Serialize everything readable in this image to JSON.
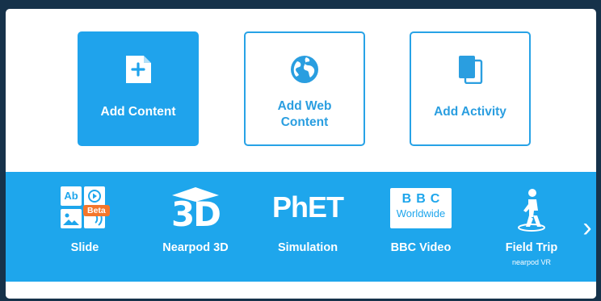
{
  "cards": {
    "add_content": "Add Content",
    "add_web_content_line1": "Add Web",
    "add_web_content_line2": "Content",
    "add_activity": "Add Activity"
  },
  "tools": {
    "slide": {
      "label": "Slide",
      "badge": "Beta",
      "ab": "Ab"
    },
    "nearpod3d": {
      "label": "Nearpod 3D",
      "icon_text": "3D"
    },
    "simulation": {
      "label": "Simulation",
      "icon_text": "PhET"
    },
    "bbc": {
      "label": "BBC Video",
      "logo_top": "BBC",
      "logo_bottom": "Worldwide"
    },
    "fieldtrip": {
      "label": "Field Trip",
      "sub": "nearpod VR"
    }
  },
  "colors": {
    "accent": "#1fa3ec",
    "badge": "#f4762b",
    "backdrop": "#16324a"
  },
  "icons": [
    "add-content-icon",
    "globe-icon",
    "activity-icon",
    "slide-icon",
    "3d-icon",
    "phet-icon",
    "bbc-logo",
    "person-walking-icon",
    "chevron-right-icon"
  ]
}
